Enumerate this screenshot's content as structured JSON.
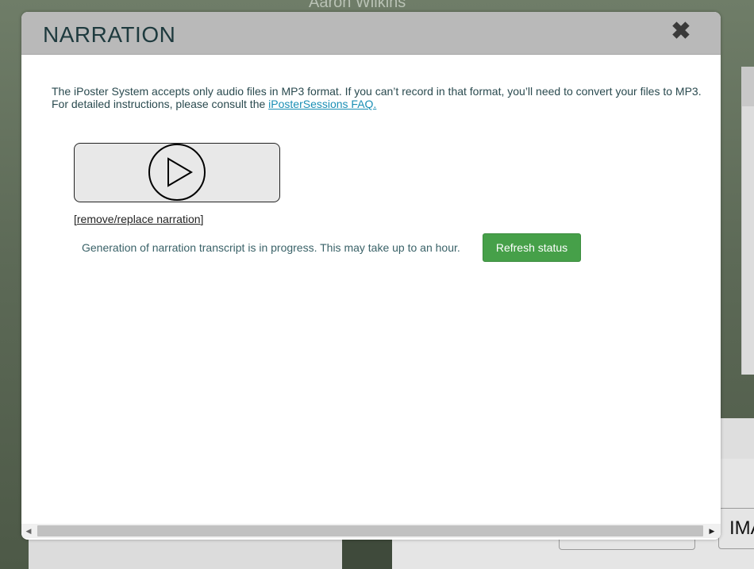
{
  "background": {
    "presenter_name": "Aaron Wilkins",
    "button_partial": "IMA"
  },
  "modal": {
    "title": "NARRATION",
    "close_icon": "close-icon",
    "intro_text": "The iPoster System accepts only audio files in MP3 format. If you can’t record in that format, you’ll need to convert your files to MP3. For detailed instructions, please consult the ",
    "faq_link": "iPosterSessions FAQ.",
    "player_icon": "play-icon",
    "remove_prefix": "[",
    "remove_link": "remove/replace narration",
    "remove_suffix": "]",
    "status_text": "Generation of narration transcript is in progress. This may take up to an hour.",
    "refresh_button": "Refresh status"
  },
  "colors": {
    "header_bg": "#b9b9b9",
    "title": "#1e3a3e",
    "link": "#1a8fb5",
    "button_green": "#46a049"
  }
}
